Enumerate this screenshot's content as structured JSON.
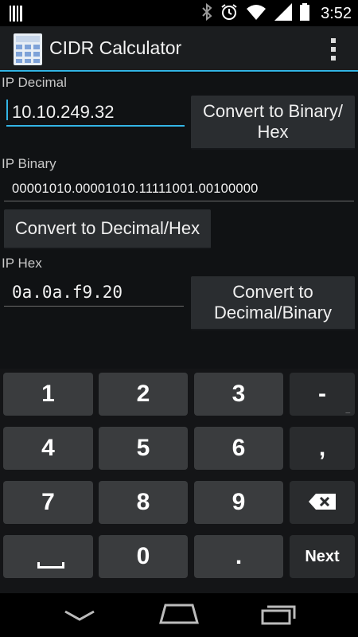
{
  "status_bar": {
    "time": "3:52",
    "icons": [
      "barcode-icon",
      "bluetooth-icon",
      "alarm-icon",
      "wifi-icon",
      "signal-icon",
      "battery-icon"
    ]
  },
  "app": {
    "title": "CIDR Calculator",
    "icon": "calculator-icon",
    "accent": "#33b5e5"
  },
  "form": {
    "decimal_label": "IP Decimal",
    "decimal_value": "10.10.249.32",
    "btn_to_binary_hex_line1": "Convert to Binary/",
    "btn_to_binary_hex_line2": "Hex",
    "binary_label": "IP Binary",
    "binary_value": "00001010.00001010.11111001.00100000",
    "btn_to_decimal_hex": "Convert to Decimal/Hex",
    "hex_label": "IP Hex",
    "hex_value": "0a.0a.f9.20",
    "btn_to_decimal_binary_line1": "Convert to",
    "btn_to_decimal_binary_line2": "Decimal/Binary"
  },
  "keyboard": {
    "k1": "1",
    "k2": "2",
    "k3": "3",
    "k_dash": "-",
    "k_dash_sub": "_",
    "k4": "4",
    "k5": "5",
    "k6": "6",
    "k_comma": ",",
    "k7": "7",
    "k8": "8",
    "k9": "9",
    "k0": "0",
    "k_dot": ".",
    "k_next": "Next"
  },
  "nav": {
    "icons": [
      "back-icon",
      "home-icon",
      "recent-apps-icon"
    ]
  }
}
